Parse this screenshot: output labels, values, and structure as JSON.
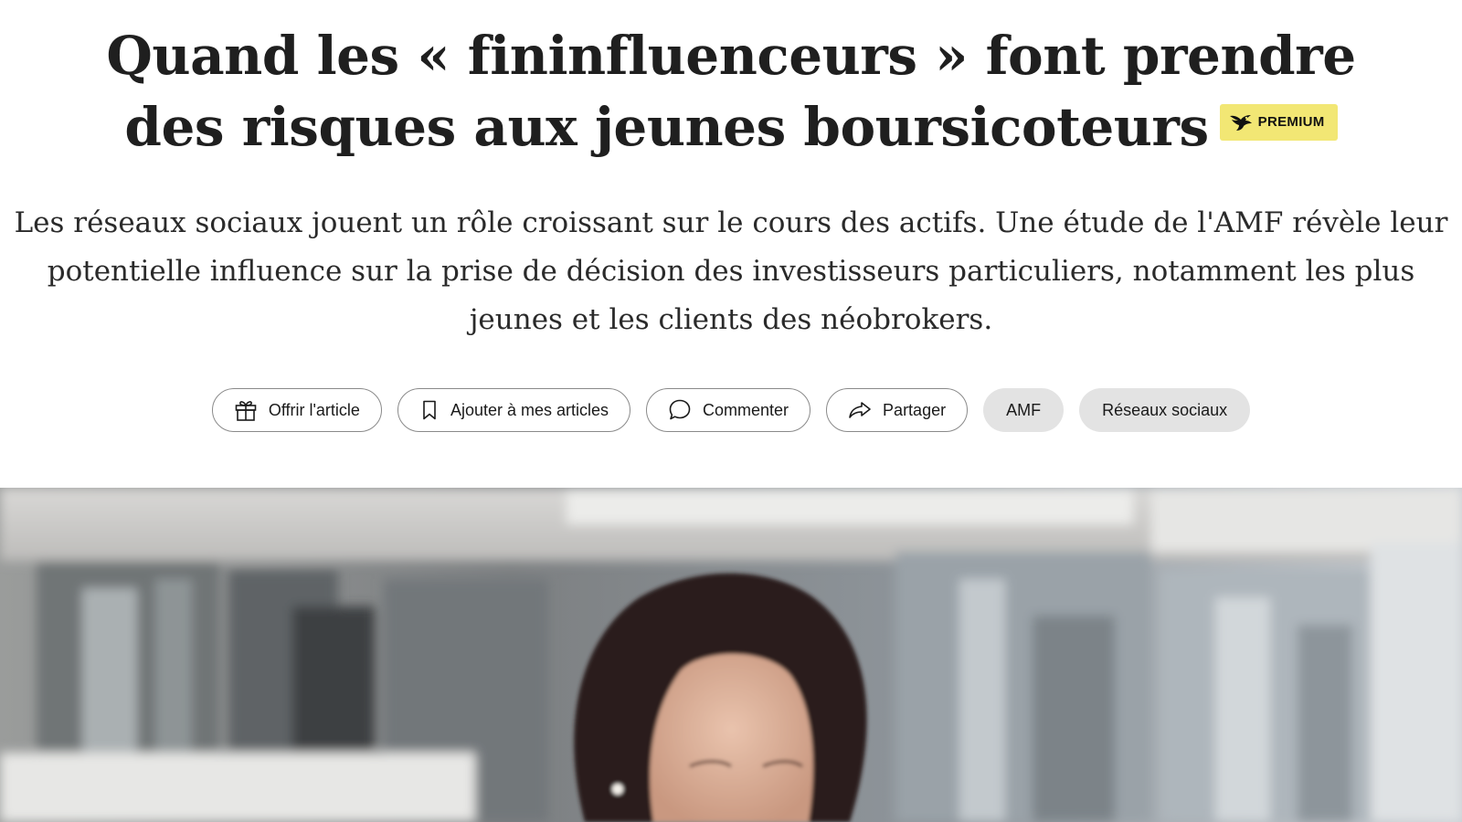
{
  "article": {
    "title": "Quand les « fininfluenceurs » font prendre des risques aux jeunes boursicoteurs",
    "premium_label": "PREMIUM",
    "subtitle": "Les réseaux sociaux jouent un rôle croissant sur le cours des actifs. Une étude de l'AMF révèle leur potentielle influence sur la prise de décision des investisseurs particuliers, notamment les plus jeunes et les clients des néobrokers."
  },
  "actions": {
    "offer_label": "Offrir l'article",
    "save_label": "Ajouter à mes articles",
    "comment_label": "Commenter",
    "share_label": "Partager"
  },
  "tags": [
    "AMF",
    "Réseaux sociaux"
  ],
  "icons": {
    "offer": "gift-icon",
    "save": "bookmark-icon",
    "comment": "speech-bubble-icon",
    "share": "share-arrow-icon",
    "premium": "bird-logo-icon"
  },
  "colors": {
    "premium_badge": "#f2e774",
    "tag_background": "#e3e3e3",
    "button_border": "#8a8a8a",
    "text": "#1f1f1f"
  }
}
